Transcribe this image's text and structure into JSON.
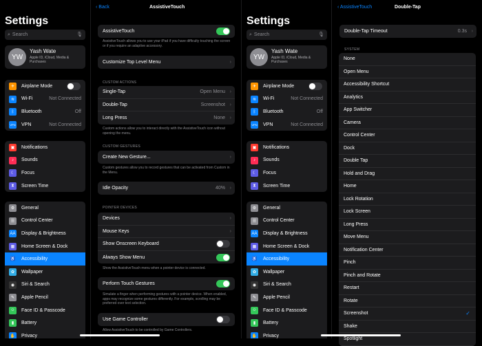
{
  "settings_title": "Settings",
  "search_placeholder": "Search",
  "profile": {
    "initials": "YW",
    "name": "Yash Wate",
    "sub": "Apple ID, iCloud, Media & Purchases"
  },
  "group1": [
    {
      "icon": "airplane-icon",
      "glyph": "✈",
      "color": "#ff9500",
      "label": "Airplane Mode",
      "toggle": false
    },
    {
      "icon": "wifi-icon",
      "glyph": "≋",
      "color": "#0a84ff",
      "label": "Wi-Fi",
      "value": "Not Connected"
    },
    {
      "icon": "bluetooth-icon",
      "glyph": "ᛒ",
      "color": "#0a84ff",
      "label": "Bluetooth",
      "value": "Off"
    },
    {
      "icon": "vpn-icon",
      "glyph": "VPN",
      "color": "#0a84ff",
      "label": "VPN",
      "value": "Not Connected"
    }
  ],
  "group2": [
    {
      "icon": "notifications-icon",
      "glyph": "▣",
      "color": "#ff3b30",
      "label": "Notifications"
    },
    {
      "icon": "sounds-icon",
      "glyph": "♪",
      "color": "#ff2d55",
      "label": "Sounds"
    },
    {
      "icon": "focus-icon",
      "glyph": "☾",
      "color": "#5e5ce6",
      "label": "Focus"
    },
    {
      "icon": "screen-time-icon",
      "glyph": "⧗",
      "color": "#5e5ce6",
      "label": "Screen Time"
    }
  ],
  "group3": [
    {
      "icon": "general-icon",
      "glyph": "⚙",
      "color": "#8e8e93",
      "label": "General"
    },
    {
      "icon": "control-center-icon",
      "glyph": "☰",
      "color": "#8e8e93",
      "label": "Control Center"
    },
    {
      "icon": "display-icon",
      "glyph": "AA",
      "color": "#0a84ff",
      "label": "Display & Brightness"
    },
    {
      "icon": "home-screen-icon",
      "glyph": "▦",
      "color": "#5e5ce6",
      "label": "Home Screen & Dock"
    },
    {
      "icon": "accessibility-icon",
      "glyph": "♿",
      "color": "#0a84ff",
      "label": "Accessibility",
      "active": true
    },
    {
      "icon": "wallpaper-icon",
      "glyph": "✿",
      "color": "#32ade6",
      "label": "Wallpaper"
    },
    {
      "icon": "siri-icon",
      "glyph": "◉",
      "color": "#333",
      "label": "Siri & Search"
    },
    {
      "icon": "apple-pencil-icon",
      "glyph": "✎",
      "color": "#8e8e93",
      "label": "Apple Pencil"
    },
    {
      "icon": "faceid-icon",
      "glyph": "☺",
      "color": "#34c759",
      "label": "Face ID & Passcode"
    },
    {
      "icon": "battery-icon",
      "glyph": "▮",
      "color": "#34c759",
      "label": "Battery"
    },
    {
      "icon": "privacy-icon",
      "glyph": "✋",
      "color": "#0a84ff",
      "label": "Privacy"
    }
  ],
  "assist": {
    "back": "Back",
    "title": "AssistiveTouch",
    "main_label": "AssistiveTouch",
    "main_note": "AssistiveTouch allows you to use your iPad if you have difficulty touching the screen or if you require an adaptive accessory.",
    "customize": "Customize Top Level Menu",
    "custom_actions_hdr": "CUSTOM ACTIONS",
    "actions": [
      {
        "label": "Single-Tap",
        "value": "Open Menu"
      },
      {
        "label": "Double-Tap",
        "value": "Screenshot"
      },
      {
        "label": "Long Press",
        "value": "None"
      }
    ],
    "actions_note": "Custom actions allow you to interact directly with the AssistiveTouch icon without opening the menu.",
    "gestures_hdr": "CUSTOM GESTURES",
    "create_gesture": "Create New Gesture...",
    "gestures_note": "Custom gestures allow you to record gestures that can be activated from Custom in the Menu.",
    "idle_label": "Idle Opacity",
    "idle_value": "40%",
    "pointer_hdr": "POINTER DEVICES",
    "devices": "Devices",
    "mouse_keys": "Mouse Keys",
    "show_keyboard": "Show Onscreen Keyboard",
    "always_show": "Always Show Menu",
    "pointer_note": "Show the AssistiveTouch menu when a pointer device is connected.",
    "perform_gestures": "Perform Touch Gestures",
    "perform_note": "Simulate a finger when performing gestures with a pointer device. When enabled, apps may recognize some gestures differently. For example, scrolling may be preferred over text selection.",
    "game_controller": "Use Game Controller",
    "game_note": "Allow AssistiveTouch to be controlled by Game Controllers."
  },
  "doubletap": {
    "back": "AssistiveTouch",
    "title": "Double-Tap",
    "timeout_label": "Double-Tap Timeout",
    "timeout_value": "0.3s",
    "system_hdr": "SYSTEM",
    "options": [
      "None",
      "Open Menu",
      "Accessibility Shortcut",
      "Analytics",
      "App Switcher",
      "Camera",
      "Control Center",
      "Dock",
      "Double Tap",
      "Hold and Drag",
      "Home",
      "Lock Rotation",
      "Lock Screen",
      "Long Press",
      "Move Menu",
      "Notification Center",
      "Pinch",
      "Pinch and Rotate",
      "Restart",
      "Rotate",
      "Screenshot",
      "Shake",
      "Spotlight"
    ],
    "selected": "Screenshot"
  }
}
